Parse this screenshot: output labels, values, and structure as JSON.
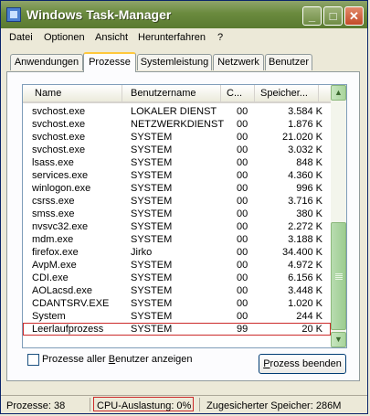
{
  "window": {
    "title": "Windows Task-Manager"
  },
  "titlebar_buttons": {
    "minimize": "_",
    "maximize": "□",
    "close": "✕"
  },
  "menu": [
    "Datei",
    "Optionen",
    "Ansicht",
    "Herunterfahren",
    "?"
  ],
  "tabs": [
    {
      "label": "Anwendungen",
      "active": false
    },
    {
      "label": "Prozesse",
      "active": true
    },
    {
      "label": "Systemleistung",
      "active": false
    },
    {
      "label": "Netzwerk",
      "active": false
    },
    {
      "label": "Benutzer",
      "active": false
    }
  ],
  "table": {
    "columns": [
      "Name",
      "Benutzername",
      "C...",
      "Speicher..."
    ],
    "rows": [
      {
        "name": "svchost.exe",
        "user": "LOKALER DIENST",
        "cpu": "00",
        "mem": "3.584 K"
      },
      {
        "name": "svchost.exe",
        "user": "NETZWERKDIENST",
        "cpu": "00",
        "mem": "1.876 K"
      },
      {
        "name": "svchost.exe",
        "user": "SYSTEM",
        "cpu": "00",
        "mem": "21.020 K"
      },
      {
        "name": "svchost.exe",
        "user": "SYSTEM",
        "cpu": "00",
        "mem": "3.032 K"
      },
      {
        "name": "lsass.exe",
        "user": "SYSTEM",
        "cpu": "00",
        "mem": "848 K"
      },
      {
        "name": "services.exe",
        "user": "SYSTEM",
        "cpu": "00",
        "mem": "4.360 K"
      },
      {
        "name": "winlogon.exe",
        "user": "SYSTEM",
        "cpu": "00",
        "mem": "996 K"
      },
      {
        "name": "csrss.exe",
        "user": "SYSTEM",
        "cpu": "00",
        "mem": "3.716 K"
      },
      {
        "name": "smss.exe",
        "user": "SYSTEM",
        "cpu": "00",
        "mem": "380 K"
      },
      {
        "name": "nvsvc32.exe",
        "user": "SYSTEM",
        "cpu": "00",
        "mem": "2.272 K"
      },
      {
        "name": "mdm.exe",
        "user": "SYSTEM",
        "cpu": "00",
        "mem": "3.188 K"
      },
      {
        "name": "firefox.exe",
        "user": "Jirko",
        "cpu": "00",
        "mem": "34.400 K"
      },
      {
        "name": "AvpM.exe",
        "user": "SYSTEM",
        "cpu": "00",
        "mem": "4.972 K"
      },
      {
        "name": "CDI.exe",
        "user": "SYSTEM",
        "cpu": "00",
        "mem": "6.156 K"
      },
      {
        "name": "AOLacsd.exe",
        "user": "SYSTEM",
        "cpu": "00",
        "mem": "3.448 K"
      },
      {
        "name": "CDANTSRV.EXE",
        "user": "SYSTEM",
        "cpu": "00",
        "mem": "1.020 K"
      },
      {
        "name": "System",
        "user": "SYSTEM",
        "cpu": "00",
        "mem": "244 K"
      },
      {
        "name": "Leerlaufprozess",
        "user": "SYSTEM",
        "cpu": "99",
        "mem": "20 K",
        "selected": true
      }
    ]
  },
  "scrollbar": {
    "up": "▲",
    "down": "▼"
  },
  "show_all_users": {
    "checked": false,
    "label_before": "Prozesse aller ",
    "label_underlined": "B",
    "label_after": "enutzer anzeigen"
  },
  "end_process": {
    "label_underlined": "P",
    "label_rest": "rozess beenden"
  },
  "status": {
    "processes": "Prozesse: 38",
    "cpu": "CPU-Auslastung: 0%",
    "commit": "Zugesicherter Speicher: 286M"
  },
  "colors": {
    "highlight_box": "#cc2b2b",
    "titlebar": "#6a8a3e"
  }
}
